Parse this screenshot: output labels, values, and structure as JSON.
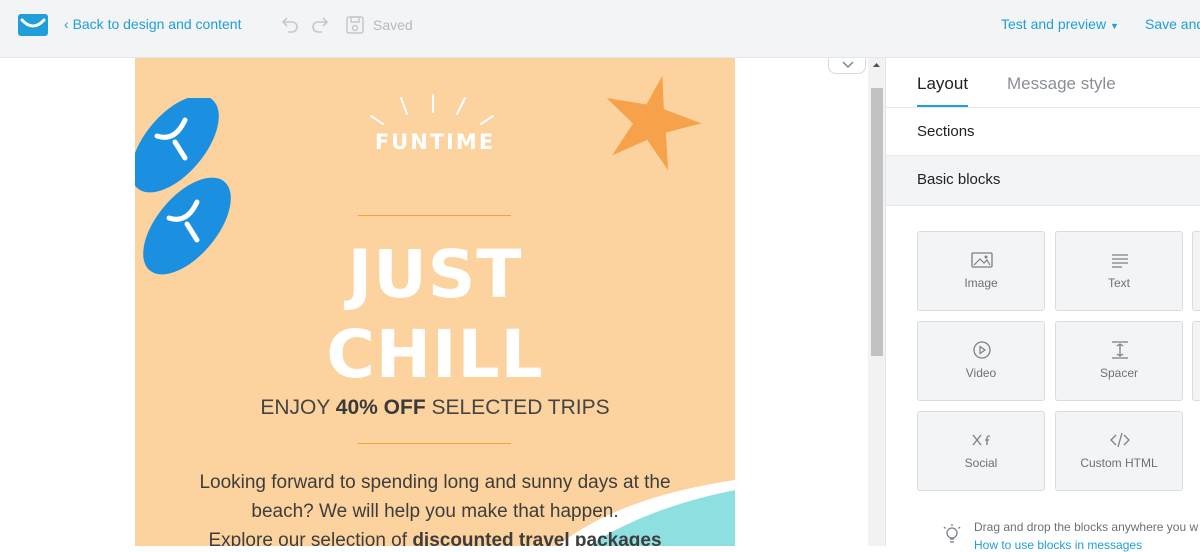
{
  "topbar": {
    "back_label": "Back to design and content",
    "saved_label": "Saved",
    "test_preview_label": "Test and preview",
    "save_label": "Save and"
  },
  "email": {
    "funtime": "FUNTIME",
    "headline_1": "JUST",
    "headline_2": "CHILL",
    "offer_prefix": "ENJOY ",
    "offer_bold": "40% OFF",
    "offer_suffix": " SELECTED TRIPS",
    "body_line_1": "Looking forward to spending long and sunny days at the",
    "body_line_2": "beach? We will help you make that happen.",
    "body_line_3_prefix": "Explore our selection of ",
    "body_line_3_bold": "discounted travel packages"
  },
  "panel": {
    "tabs": [
      {
        "label": "Layout",
        "active": true
      },
      {
        "label": "Message style",
        "active": false
      }
    ],
    "sections_label": "Sections",
    "basic_blocks_label": "Basic blocks",
    "blocks": [
      {
        "label": "Image",
        "icon": "image-icon"
      },
      {
        "label": "Text",
        "icon": "text-icon"
      },
      {
        "label": "Video",
        "icon": "video-icon"
      },
      {
        "label": "Spacer",
        "icon": "spacer-icon"
      },
      {
        "label": "Social",
        "icon": "social-icon"
      },
      {
        "label": "Custom HTML",
        "icon": "code-icon"
      }
    ],
    "hint": "Drag and drop the blocks anywhere you w",
    "hint_link": "How to use blocks in messages"
  },
  "colors": {
    "accent": "#1f9ed9",
    "email_bg": "#fcd39e",
    "starfish": "#f5a24a",
    "flipflop": "#1b8fe0",
    "sea": "#8ee0e0"
  }
}
